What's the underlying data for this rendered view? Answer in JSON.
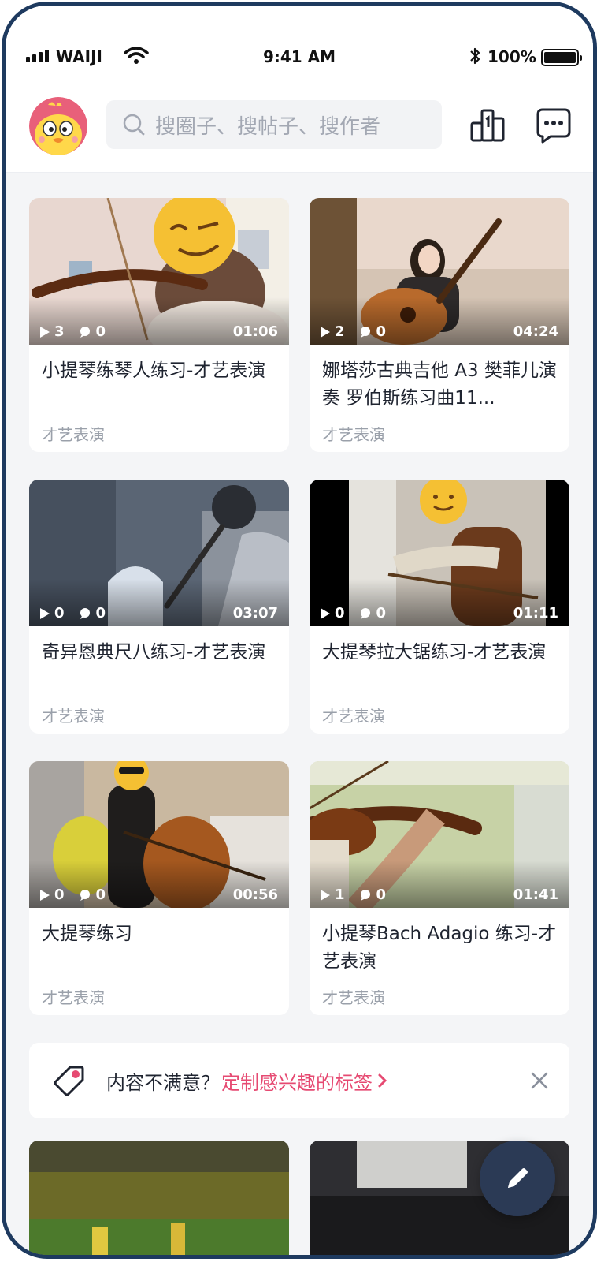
{
  "status_bar": {
    "carrier": "WAIJI",
    "time": "9:41 AM",
    "battery": "100%",
    "battery_level": 1.0
  },
  "header": {
    "avatar_icon": "chick-avatar-icon",
    "search_placeholder": "搜圈子、搜帖子、搜作者",
    "ranking_icon": "leaderboard-icon",
    "message_icon": "message-bubble-icon"
  },
  "feed": {
    "cards": [
      {
        "title": "小提琴练琴人练习-才艺表演",
        "tag": "才艺表演",
        "plays": "3",
        "comments": "0",
        "duration": "01:06"
      },
      {
        "title": "娜塔莎古典吉他 A3 樊菲儿演奏 罗伯斯练习曲11...",
        "tag": "才艺表演",
        "plays": "2",
        "comments": "0",
        "duration": "04:24"
      },
      {
        "title": "奇异恩典尺八练习-才艺表演",
        "tag": "才艺表演",
        "plays": "0",
        "comments": "0",
        "duration": "03:07"
      },
      {
        "title": "大提琴拉大锯练习-才艺表演",
        "tag": "才艺表演",
        "plays": "0",
        "comments": "0",
        "duration": "01:11"
      },
      {
        "title": "大提琴练习",
        "tag": "才艺表演",
        "plays": "0",
        "comments": "0",
        "duration": "00:56"
      },
      {
        "title": "小提琴Bach Adagio 练习-才艺表演",
        "tag": "才艺表演",
        "plays": "1",
        "comments": "0",
        "duration": "01:41"
      }
    ]
  },
  "banner": {
    "text": "内容不满意？",
    "link": "定制感兴趣的标签",
    "link_icon": "chevron-right-icon",
    "close_icon": "close-icon"
  },
  "fab": {
    "icon": "pencil-icon"
  },
  "colors": {
    "accent": "#e64a72",
    "fab": "#2b3a55",
    "frame": "#1e3a5f"
  }
}
